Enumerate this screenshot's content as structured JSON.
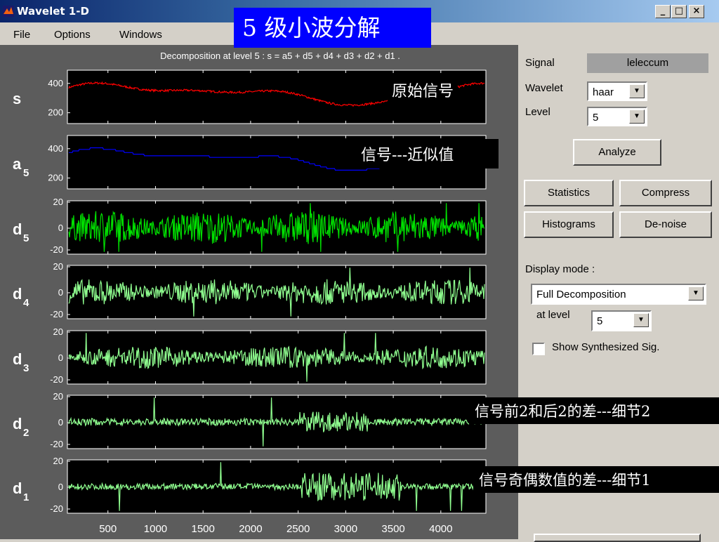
{
  "window": {
    "title": "Wavelet 1-D"
  },
  "menu": [
    "File",
    "Options",
    "Windows"
  ],
  "banner": "5 级小波分解",
  "plot": {
    "title": "Decomposition at level 5 : s = a5 + d5 + d4 + d3 + d2 + d1 .",
    "x_ticks": [
      "500",
      "1000",
      "1500",
      "2000",
      "2500",
      "3000",
      "3500",
      "4000"
    ],
    "rows": [
      {
        "label": "s",
        "sub": "",
        "ticks": [
          "400",
          "200"
        ],
        "color": "#ff0000"
      },
      {
        "label": "a",
        "sub": "5",
        "ticks": [
          "400",
          "200"
        ],
        "color": "#0000ff"
      },
      {
        "label": "d",
        "sub": "5",
        "ticks": [
          "20",
          "0",
          "-20"
        ],
        "color": "#00e000"
      },
      {
        "label": "d",
        "sub": "4",
        "ticks": [
          "20",
          "0",
          "-20"
        ],
        "color": "#90ff90"
      },
      {
        "label": "d",
        "sub": "3",
        "ticks": [
          "20",
          "0",
          "-20"
        ],
        "color": "#90ff90"
      },
      {
        "label": "d",
        "sub": "2",
        "ticks": [
          "20",
          "0",
          "-20"
        ],
        "color": "#90ff90"
      },
      {
        "label": "d",
        "sub": "1",
        "ticks": [
          "20",
          "0",
          "-20"
        ],
        "color": "#90ff90"
      }
    ]
  },
  "annotations": {
    "original": "原始信号",
    "approx": "信号---近似值",
    "detail2": "信号前2和后2的差---细节2",
    "detail1": "信号奇偶数值的差---细节1"
  },
  "panel": {
    "signal_label": "Signal",
    "signal_value": "leleccum",
    "wavelet_label": "Wavelet",
    "wavelet_value": "haar",
    "level_label": "Level",
    "level_value": "5",
    "analyze": "Analyze",
    "statistics": "Statistics",
    "compress": "Compress",
    "histograms": "Histograms",
    "denoise": "De-noise",
    "display_mode_label": "Display mode :",
    "display_mode_value": "Full Decomposition",
    "at_level_label": "at level",
    "at_level_value": "5",
    "show_synth": "Show Synthesized Sig."
  }
}
